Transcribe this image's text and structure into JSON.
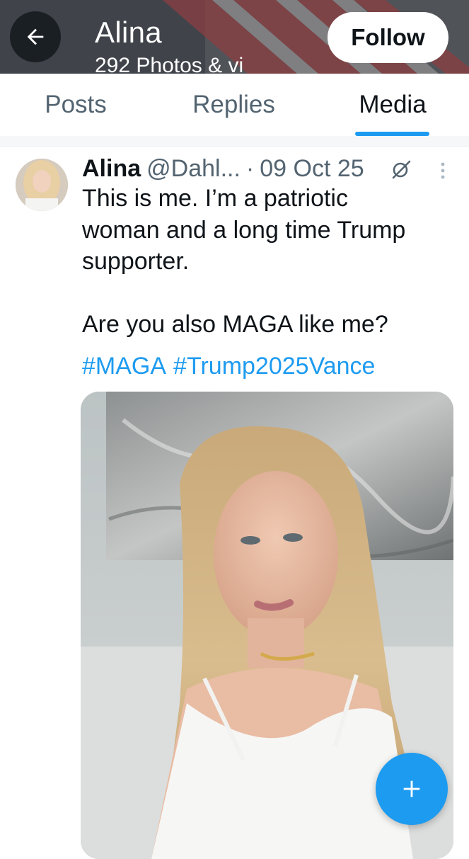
{
  "header": {
    "name": "Alina",
    "subtitle": "292 Photos & vi",
    "follow_label": "Follow",
    "back_icon": "arrow-left-icon"
  },
  "tabs": [
    {
      "label": "Posts",
      "active": false
    },
    {
      "label": "Replies",
      "active": false
    },
    {
      "label": "Media",
      "active": true
    }
  ],
  "post": {
    "author": "Alina",
    "handle": "@Dahl...",
    "separator": "·",
    "date": "09 Oct 25",
    "text": "This is me. I’m a patriotic\nwoman and a long time Trump\nsupporter.\n\nAre you also MAGA like me?",
    "hashtags": [
      "#MAGA",
      "#Trump2025Vance"
    ],
    "grok_icon": "grok-slash-icon",
    "more_icon": "more-vertical-icon"
  },
  "compose_icon": "plus-icon",
  "colors": {
    "accent": "#1d9bf0",
    "text_primary": "#0f1419",
    "text_secondary": "#536471"
  }
}
